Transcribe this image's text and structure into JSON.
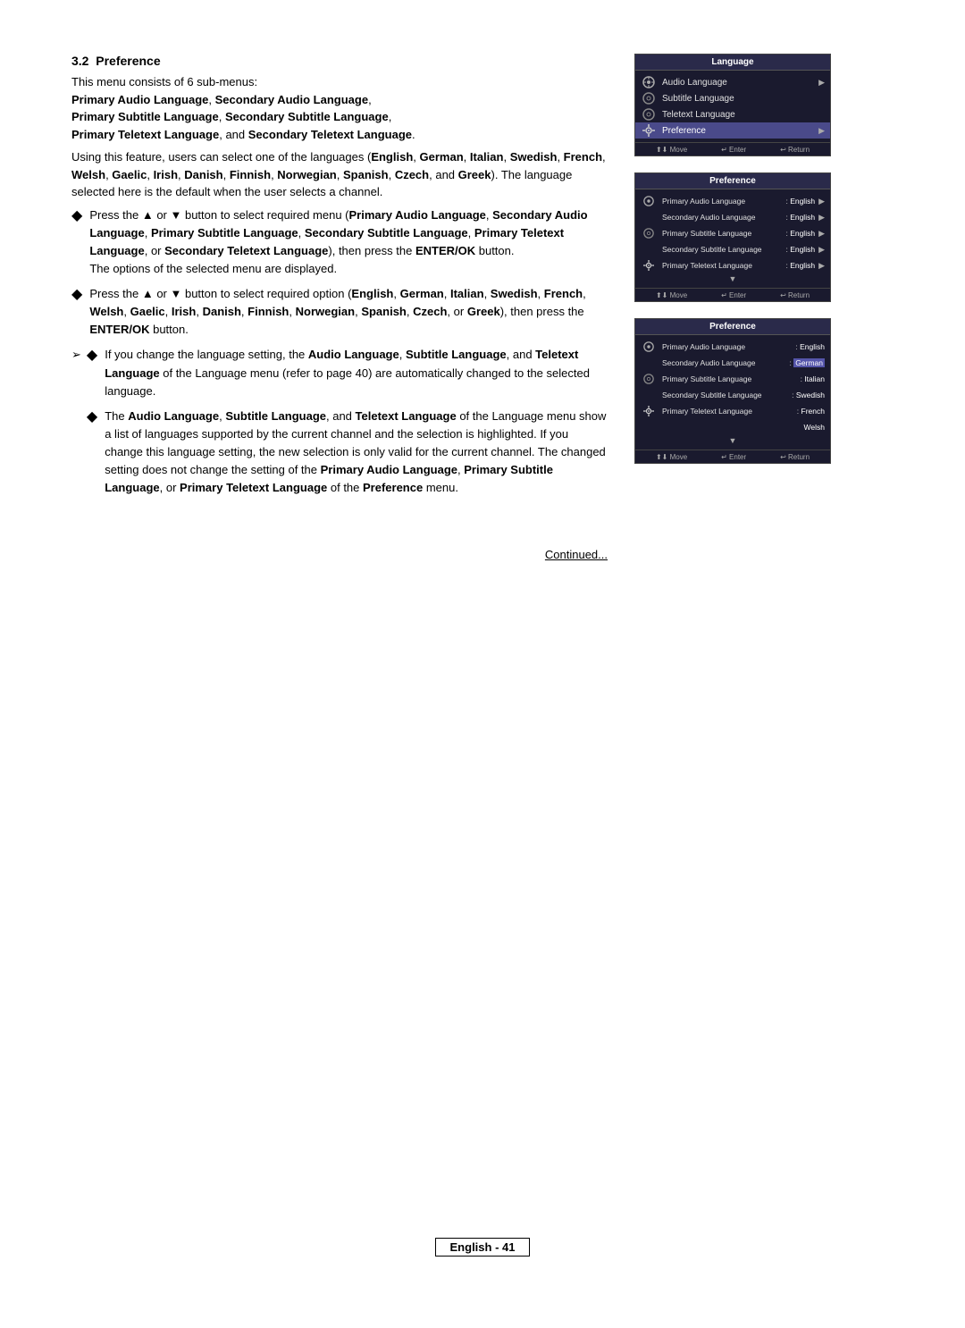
{
  "page": {
    "section": "3.2",
    "section_title": "Preference",
    "intro": "This menu consists of 6 sub-menus:",
    "submenus_bold": "Primary Audio Language, Secondary Audio Language, Primary Subtitle Language, Secondary Subtitle Language, Primary Teletext Language, and Secondary Teletext Language.",
    "description": "Using this feature, users can select one of the languages (English, German, Italian, Swedish, French, Welsh, Gaelic, Irish, Danish, Finnish, Norwegian, Spanish, Czech, and Greek). The language selected here is the default when the user selects a channel.",
    "bullets": [
      {
        "text_parts": [
          {
            "text": "Press the ▲ or ▼ button to select required menu (",
            "bold": false
          },
          {
            "text": "Primary Audio Language",
            "bold": true
          },
          {
            "text": ", ",
            "bold": false
          },
          {
            "text": "Secondary Audio Language",
            "bold": true
          },
          {
            "text": ", ",
            "bold": false
          },
          {
            "text": "Primary Subtitle Language",
            "bold": true
          },
          {
            "text": ", ",
            "bold": false
          },
          {
            "text": "Secondary Subtitle Language",
            "bold": true
          },
          {
            "text": ", ",
            "bold": false
          },
          {
            "text": "Primary Teletext Language",
            "bold": true
          },
          {
            "text": ", or ",
            "bold": false
          },
          {
            "text": "Secondary Teletext Language",
            "bold": true
          },
          {
            "text": "), then press the ",
            "bold": false
          },
          {
            "text": "ENTER/OK",
            "bold": true
          },
          {
            "text": " button. The options of the selected menu are displayed.",
            "bold": false
          }
        ]
      },
      {
        "text_parts": [
          {
            "text": "Press the ▲ or ▼ button to select required option (",
            "bold": false
          },
          {
            "text": "English",
            "bold": true
          },
          {
            "text": ", ",
            "bold": false
          },
          {
            "text": "German",
            "bold": true
          },
          {
            "text": ", ",
            "bold": false
          },
          {
            "text": "Italian",
            "bold": true
          },
          {
            "text": ", ",
            "bold": false
          },
          {
            "text": "Swedish",
            "bold": true
          },
          {
            "text": ", ",
            "bold": false
          },
          {
            "text": "French",
            "bold": true
          },
          {
            "text": ", ",
            "bold": false
          },
          {
            "text": "Welsh",
            "bold": true
          },
          {
            "text": ", ",
            "bold": false
          },
          {
            "text": "Gaelic",
            "bold": true
          },
          {
            "text": ", ",
            "bold": false
          },
          {
            "text": "Irish",
            "bold": true
          },
          {
            "text": ", ",
            "bold": false
          },
          {
            "text": "Danish",
            "bold": true
          },
          {
            "text": ", ",
            "bold": false
          },
          {
            "text": "Finnish",
            "bold": true
          },
          {
            "text": ", ",
            "bold": false
          },
          {
            "text": "Norwegian",
            "bold": true
          },
          {
            "text": ", ",
            "bold": false
          },
          {
            "text": "Spanish",
            "bold": true
          },
          {
            "text": ", ",
            "bold": false
          },
          {
            "text": "Czech",
            "bold": true
          },
          {
            "text": ", or ",
            "bold": false
          },
          {
            "text": "Greek",
            "bold": true
          },
          {
            "text": "), then press the ",
            "bold": false
          },
          {
            "text": "ENTER/OK",
            "bold": true
          },
          {
            "text": " button.",
            "bold": false
          }
        ]
      }
    ],
    "arrow_note": {
      "prefix": "➢",
      "diamond": "◆",
      "text_parts": [
        {
          "text": "If you change the language setting, the ",
          "bold": false
        },
        {
          "text": "Audio Language",
          "bold": true
        },
        {
          "text": ", ",
          "bold": false
        },
        {
          "text": "Subtitle Language",
          "bold": true
        },
        {
          "text": ", and ",
          "bold": false
        },
        {
          "text": "Teletext Language",
          "bold": true
        },
        {
          "text": " of the Language menu (refer to page 40) are automatically changed to the selected language.",
          "bold": false
        }
      ]
    },
    "last_bullet": {
      "text_parts": [
        {
          "text": "The ",
          "bold": false
        },
        {
          "text": "Audio Language",
          "bold": true
        },
        {
          "text": ", ",
          "bold": false
        },
        {
          "text": "Subtitle Language",
          "bold": true
        },
        {
          "text": ", and ",
          "bold": false
        },
        {
          "text": "Teletext Language",
          "bold": true
        },
        {
          "text": " of the Language menu show a list of languages supported by the current channel and the selection is highlighted. If you change this language setting, the new selection is only valid for the current channel. The changed setting does not change the setting of the ",
          "bold": false
        },
        {
          "text": "Primary Audio Language",
          "bold": true
        },
        {
          "text": ", ",
          "bold": false
        },
        {
          "text": "Primary Subtitle Language",
          "bold": true
        },
        {
          "text": ", or ",
          "bold": false
        },
        {
          "text": "Primary Teletext Language",
          "bold": true
        },
        {
          "text": " of the ",
          "bold": false
        },
        {
          "text": "Preference",
          "bold": true
        },
        {
          "text": " menu.",
          "bold": false
        }
      ]
    },
    "continued": "Continued...",
    "footer": "English - 41"
  },
  "panels": {
    "panel1": {
      "title": "Language",
      "rows": [
        {
          "icon": "satellite",
          "text": "Audio Language",
          "value": "",
          "arrow": true,
          "highlighted": false
        },
        {
          "icon": "disc",
          "text": "Subtitle Language",
          "value": "",
          "arrow": false,
          "highlighted": false
        },
        {
          "icon": "disc",
          "text": "Teletext Language",
          "value": "",
          "arrow": false,
          "highlighted": false
        },
        {
          "icon": "gear",
          "text": "Preference",
          "value": "",
          "arrow": true,
          "highlighted": true
        }
      ],
      "footer": [
        "⬆⬇ Move",
        "↵ Enter",
        "↩ Return"
      ]
    },
    "panel2": {
      "title": "Preference",
      "rows": [
        {
          "icon": "satellite",
          "label": "Primary Audio Language",
          "value": "English",
          "arrow": true,
          "highlighted": false
        },
        {
          "icon": "",
          "label": "Secondary Audio Language",
          "value": "English",
          "arrow": true,
          "highlighted": false
        },
        {
          "icon": "disc",
          "label": "Primary Subtitle Language",
          "value": "English",
          "arrow": true,
          "highlighted": false
        },
        {
          "icon": "",
          "label": "Secondary Subtitle Language",
          "value": "English",
          "arrow": true,
          "highlighted": false
        },
        {
          "icon": "gear",
          "label": "Primary Teletext Language",
          "value": "English",
          "arrow": true,
          "highlighted": false
        }
      ],
      "down_arrow": "▼",
      "footer": [
        "⬆⬇ Move",
        "↵ Enter",
        "↩ Return"
      ]
    },
    "panel3": {
      "title": "Preference",
      "rows": [
        {
          "icon": "satellite",
          "label": "Primary Audio Language",
          "value": "English",
          "highlighted": false
        },
        {
          "icon": "",
          "label": "Secondary Audio Language",
          "value": "German",
          "highlighted": true
        },
        {
          "icon": "disc",
          "label": "Primary Subtitle Language",
          "value": "Italian",
          "highlighted": false
        },
        {
          "icon": "",
          "label": "Secondary Subtitle Language",
          "value": "Swedish",
          "highlighted": false
        },
        {
          "icon": "gear",
          "label": "Primary Teletext Language",
          "value": "French",
          "highlighted": false
        },
        {
          "icon": "",
          "label": "",
          "value": "Welsh",
          "highlighted": false
        }
      ],
      "down_arrow": "▼",
      "footer": [
        "⬆⬇ Move",
        "↵ Enter",
        "↩ Return"
      ]
    }
  }
}
